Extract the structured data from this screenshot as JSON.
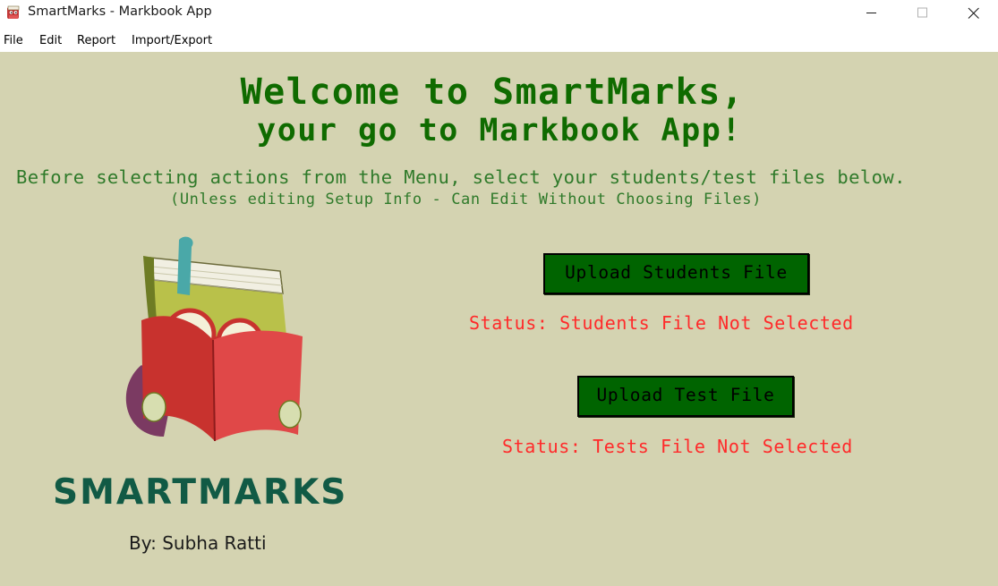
{
  "window": {
    "title": "SmartMarks - Markbook App",
    "app_icon": "bookworm-app-icon",
    "controls": {
      "minimize_icon": "minimize-icon",
      "maximize_icon": "maximize-icon",
      "close_icon": "close-icon"
    }
  },
  "menu": {
    "file": "File",
    "edit": "Edit",
    "report": "Report",
    "import_export": "Import/Export"
  },
  "main": {
    "welcome_line1": "Welcome to SmartMarks,",
    "welcome_line2": "your go to Markbook App!",
    "instruction": "Before selecting actions from the Menu, select your students/test files below.",
    "instruction_sub": "(Unless editing Setup Info - Can Edit Without Choosing Files)",
    "logo": {
      "brand": "SMARTMARKS",
      "author": "By: Subha Ratti"
    },
    "students": {
      "button_label": "Upload Students File",
      "status": "Status: Students File Not Selected"
    },
    "tests": {
      "button_label": "Upload Test File",
      "status": "Status: Tests File Not Selected"
    }
  },
  "colors": {
    "background": "#d4d3b1",
    "heading": "#0f6b00",
    "instruction": "#2f7a2a",
    "button": "#006400",
    "status": "#ff2a2a",
    "brand": "#115a45"
  }
}
